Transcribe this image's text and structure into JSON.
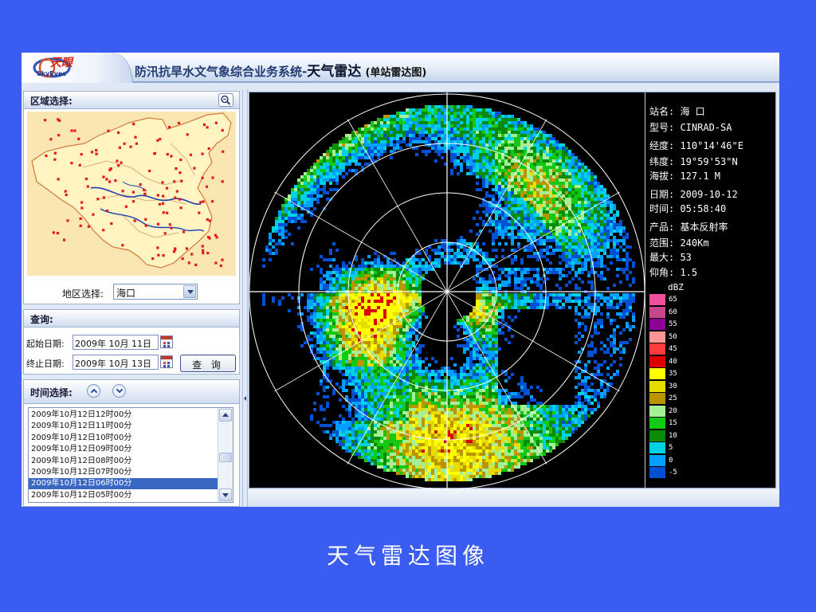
{
  "header": {
    "logo_cn": "天眼",
    "logo_en": "SkyEyes",
    "title_main": "防汛抗旱水文气象综合业务系统-",
    "title_sub": "天气雷达",
    "title_paren": "(单站雷达图)"
  },
  "region": {
    "title": "区域选择:",
    "zoom_icon": "zoom-icon",
    "area_label": "地区选择:",
    "area_value": "海口"
  },
  "query": {
    "title": "查询:",
    "start_label": "起始日期:",
    "start_value": "2009年 10月 11日",
    "end_label": "终止日期:",
    "end_value": "2009年 10月 13日",
    "button_label": "查 询"
  },
  "time": {
    "title": "时间选择:",
    "items": [
      "2009年10月12日12时00分",
      "2009年10月12日11时00分",
      "2009年10月12日10时00分",
      "2009年10月12日09时00分",
      "2009年10月12日08时00分",
      "2009年10月12日07时00分",
      "2009年10月12日06时00分",
      "2009年10月12日05时00分"
    ],
    "selected_index": 6
  },
  "radar_info": {
    "station": "站名: 海 口",
    "model": "型号: CINRAD-SA",
    "longitude": "经度: 110°14'46\"E",
    "latitude": "纬度:  19°59'53\"N",
    "altitude": "海拔: 127.1 M",
    "date": "日期: 2009-10-12",
    "time": "时间: 05:58:40",
    "product": "产品: 基本反射率",
    "range": "范围: 240Km",
    "max": "最大: 53",
    "elevation": "仰角: 1.5"
  },
  "legend": {
    "unit": "dBZ",
    "entries": [
      {
        "label": "65",
        "color": "#f0509a"
      },
      {
        "label": "60",
        "color": "#c8468c"
      },
      {
        "label": "55",
        "color": "#8c0096"
      },
      {
        "label": "50",
        "color": "#ff9696"
      },
      {
        "label": "45",
        "color": "#ff3c3c"
      },
      {
        "label": "40",
        "color": "#dc0000"
      },
      {
        "label": "35",
        "color": "#ffff00"
      },
      {
        "label": "30",
        "color": "#e6dc00"
      },
      {
        "label": "25",
        "color": "#b99600"
      },
      {
        "label": "20",
        "color": "#a5f096"
      },
      {
        "label": "15",
        "color": "#14c814"
      },
      {
        "label": "10",
        "color": "#0a8c0a"
      },
      {
        "label": "5",
        "color": "#00d2e6"
      },
      {
        "label": "0",
        "color": "#00a0ff"
      },
      {
        "label": "-5",
        "color": "#0050d2"
      }
    ]
  },
  "caption": "天气雷达图像",
  "chart_data": {
    "type": "heatmap",
    "title": "天气雷达",
    "product": "基本反射率",
    "unit": "dBZ",
    "range_km": 240,
    "max": 53,
    "elevation": 1.5,
    "scale_values": [
      65,
      60,
      55,
      50,
      45,
      40,
      35,
      30,
      25,
      20,
      15,
      10,
      5,
      0,
      -5
    ]
  }
}
